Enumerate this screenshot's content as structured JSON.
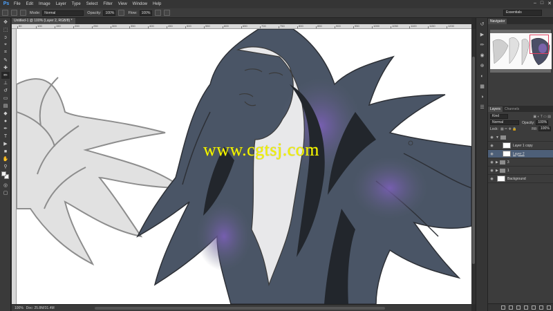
{
  "app": {
    "logo": "Ps"
  },
  "menu": [
    "File",
    "Edit",
    "Image",
    "Layer",
    "Type",
    "Select",
    "Filter",
    "View",
    "Window",
    "Help"
  ],
  "window_controls": [
    "–",
    "□",
    "✕"
  ],
  "options": {
    "mode_label": "Mode:",
    "mode_value": "Normal",
    "opacity_label": "Opacity:",
    "opacity_value": "100%",
    "flow_label": "Flow:",
    "flow_value": "100%",
    "workspace": "Essentials"
  },
  "document": {
    "tab_title": "Untitled-1 @ 100% (Layer 2, RGB/8) *",
    "ruler_marks": [
      "50",
      "100",
      "150",
      "200",
      "250",
      "300",
      "350",
      "400",
      "450",
      "500",
      "550",
      "600",
      "650",
      "700",
      "750",
      "800",
      "850",
      "900",
      "950",
      "1000",
      "1050",
      "1100",
      "1150",
      "1200"
    ],
    "watermark": "www.cgtsj.com"
  },
  "status": {
    "zoom": "100%",
    "doc_size": "Doc: 25.8M/31.4M"
  },
  "navigator": {
    "tab": "Navigator"
  },
  "layers_panel": {
    "tabs": [
      "Layers",
      "Channels"
    ],
    "kind_label": "Kind",
    "blend_mode": "Normal",
    "opacity_label": "Opacity:",
    "opacity_value": "100%",
    "lock_label": "Lock:",
    "fill_label": "Fill:",
    "fill_value": "100%",
    "layers": [
      {
        "name": "",
        "type": "group-open",
        "selected": false
      },
      {
        "name": "Layer 1 copy",
        "type": "layer",
        "selected": false
      },
      {
        "name": "Layer 2",
        "type": "layer",
        "selected": true
      },
      {
        "name": "3",
        "type": "group",
        "selected": false
      },
      {
        "name": "1",
        "type": "group",
        "selected": false
      },
      {
        "name": "Background",
        "type": "background",
        "selected": false
      }
    ]
  }
}
